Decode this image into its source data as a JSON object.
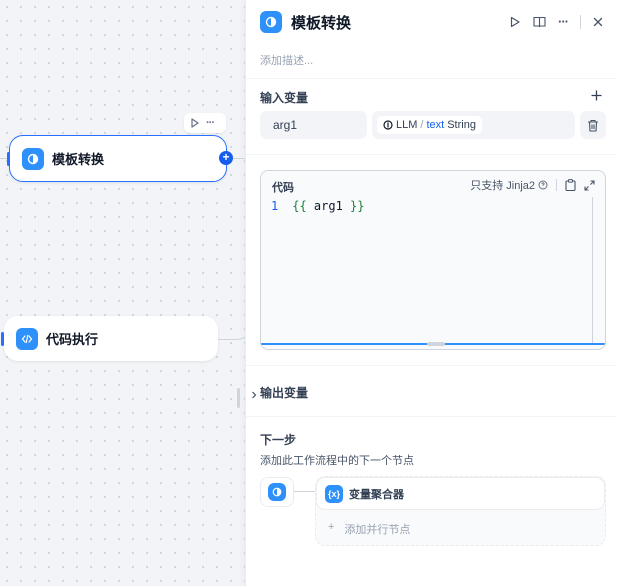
{
  "canvas": {
    "nodes": [
      {
        "label": "模板转换",
        "icon": "template-icon",
        "selected": true
      },
      {
        "label": "代码执行",
        "icon": "code-icon",
        "selected": false
      }
    ]
  },
  "panel": {
    "title": "模板转换",
    "description_placeholder": "添加描述...",
    "input_section": {
      "title": "输入变量",
      "variable_name": "arg1",
      "source_node": "LLM",
      "separator": "/",
      "source_var": "text",
      "source_type": "String"
    },
    "code": {
      "label": "代码",
      "support_text": "只支持 Jinja2",
      "line_number": "1",
      "open_brace": "{{",
      "content": " arg1 ",
      "close_brace": "}}"
    },
    "output_section": {
      "title": "输出变量"
    },
    "next_step": {
      "title": "下一步",
      "subtitle": "添加此工作流程中的下一个节点",
      "next_node_label": "变量聚合器",
      "add_parallel_label": "添加并行节点",
      "add_parallel_plus": "+"
    }
  },
  "icons": {
    "run": "play-icon",
    "split": "book-icon",
    "more": "more-icon",
    "close": "close-icon",
    "add": "plus-icon",
    "delete": "trash-icon",
    "help": "help-circle-icon",
    "copy": "clipboard-icon",
    "expand": "expand-icon",
    "chevron": "chevron-right-icon"
  },
  "colors": {
    "accent": "#2970ff",
    "node_icon": "#2e90fa"
  }
}
